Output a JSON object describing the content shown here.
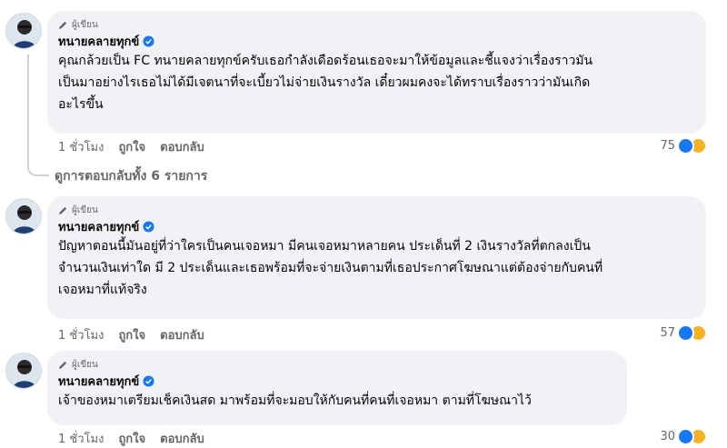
{
  "comments": [
    {
      "badge": "ผู้เขียน",
      "author": "ทนายคลายทุกข์",
      "text_lines": [
        "คุณกล้วยเป็น FC ทนายคลายทุกข์ครับเธอกำลังเดือดร้อนเธอจะมาให้ข้อมูลและชี้แจงว่าเรื่องราวมัน",
        "เป็นมาอย่างไรเธอไม่ได้มีเจตนาที่จะเบี้ยวไม่จ่ายเงินรางวัล เดี๋ยวผมคงจะได้ทราบเรื่องราวว่ามันเกิด",
        "อะไรขึ้น"
      ],
      "time": "1 ชั่วโมง",
      "like_label": "ถูกใจ",
      "reply_label": "ตอบกลับ",
      "reaction_count": "75"
    },
    {
      "badge": "ผู้เขียน",
      "author": "ทนายคลายทุกข์",
      "text_lines": [
        "ปัญหาตอนนี้มันอยู่ที่ว่าใครเป็นคนเจอหมา มีคนเจอหมาหลายคน ประเด็นที่ 2 เงินรางวัลที่ตกลงเป็น",
        "จำนวนเงินเท่าใด มี 2 ประเด็นและเธอพร้อมที่จะจ่ายเงินตามที่เธอประกาศโฆษณาแต่ต้องจ่ายกับคนที่",
        "เจอหมาที่แท้จริง"
      ],
      "time": "1 ชั่วโมง",
      "like_label": "ถูกใจ",
      "reply_label": "ตอบกลับ",
      "reaction_count": "57"
    },
    {
      "badge": "ผู้เขียน",
      "author": "ทนายคลายทุกข์",
      "text_lines": [
        "เจ้าของหมาเตรียมเช็คเงินสด มาพร้อมที่จะมอบให้กับคนที่คนที่เจอหมา ตามที่โฆษณาไว้"
      ],
      "time": "1 ชั่วโมง",
      "like_label": "ถูกใจ",
      "reply_label": "ตอบกลับ",
      "reaction_count": "30"
    }
  ],
  "view_replies": "ดูการตอบกลับทั้ง 6 รายการ",
  "colors": {
    "bubble": "#f0f2f5",
    "secondary_text": "#65676b",
    "like_blue": "#1877f2",
    "haha_yellow": "#f7b125"
  },
  "icons": [
    "pencil-icon",
    "verified-badge-icon",
    "like-reaction-icon",
    "haha-reaction-icon",
    "avatar"
  ]
}
